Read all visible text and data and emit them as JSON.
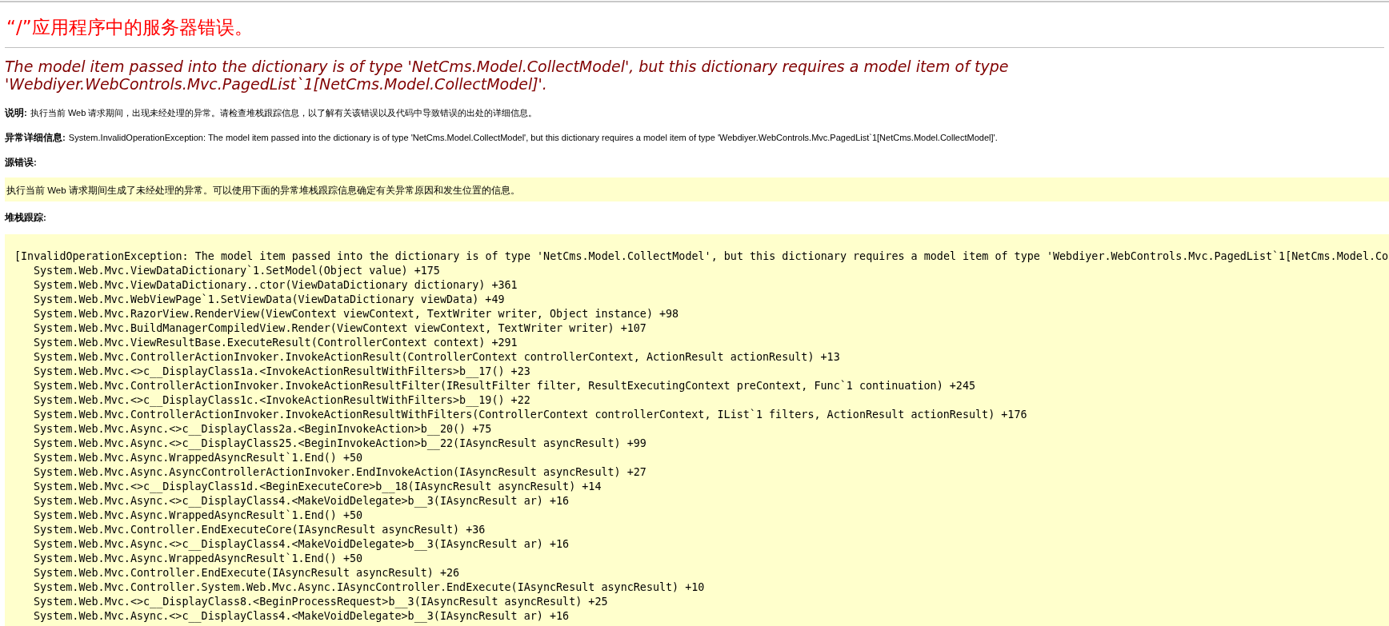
{
  "title": "“/”应用程序中的服务器错误。",
  "error_message": "The model item passed into the dictionary is of type 'NetCms.Model.CollectModel', but this dictionary requires a model item of type 'Webdiyer.WebControls.Mvc.PagedList`1[NetCms.Model.CollectModel]'.",
  "description": {
    "label": "说明:",
    "text": "执行当前 Web 请求期间，出现未经处理的异常。请检查堆栈跟踪信息，以了解有关该错误以及代码中导致错误的出处的详细信息。"
  },
  "exception_details": {
    "label": "异常详细信息:",
    "text": "System.InvalidOperationException: The model item passed into the dictionary is of type 'NetCms.Model.CollectModel', but this dictionary requires a model item of type 'Webdiyer.WebControls.Mvc.PagedList`1[NetCms.Model.CollectModel]'."
  },
  "source_error": {
    "label": "源错误:",
    "text": "执行当前 Web 请求期间生成了未经处理的异常。可以使用下面的异常堆栈跟踪信息确定有关异常原因和发生位置的信息。"
  },
  "stack_trace": {
    "label": "堆栈跟踪:",
    "exception_line": "[InvalidOperationException: The model item passed into the dictionary is of type 'NetCms.Model.CollectModel', but this dictionary requires a model item of type 'Webdiyer.WebControls.Mvc.PagedList`1[NetCms.Model.Co",
    "frames": [
      "System.Web.Mvc.ViewDataDictionary`1.SetModel(Object value) +175",
      "System.Web.Mvc.ViewDataDictionary..ctor(ViewDataDictionary dictionary) +361",
      "System.Web.Mvc.WebViewPage`1.SetViewData(ViewDataDictionary viewData) +49",
      "System.Web.Mvc.RazorView.RenderView(ViewContext viewContext, TextWriter writer, Object instance) +98",
      "System.Web.Mvc.BuildManagerCompiledView.Render(ViewContext viewContext, TextWriter writer) +107",
      "System.Web.Mvc.ViewResultBase.ExecuteResult(ControllerContext context) +291",
      "System.Web.Mvc.ControllerActionInvoker.InvokeActionResult(ControllerContext controllerContext, ActionResult actionResult) +13",
      "System.Web.Mvc.<>c__DisplayClass1a.<InvokeActionResultWithFilters>b__17() +23",
      "System.Web.Mvc.ControllerActionInvoker.InvokeActionResultFilter(IResultFilter filter, ResultExecutingContext preContext, Func`1 continuation) +245",
      "System.Web.Mvc.<>c__DisplayClass1c.<InvokeActionResultWithFilters>b__19() +22",
      "System.Web.Mvc.ControllerActionInvoker.InvokeActionResultWithFilters(ControllerContext controllerContext, IList`1 filters, ActionResult actionResult) +176",
      "System.Web.Mvc.Async.<>c__DisplayClass2a.<BeginInvokeAction>b__20() +75",
      "System.Web.Mvc.Async.<>c__DisplayClass25.<BeginInvokeAction>b__22(IAsyncResult asyncResult) +99",
      "System.Web.Mvc.Async.WrappedAsyncResult`1.End() +50",
      "System.Web.Mvc.Async.AsyncControllerActionInvoker.EndInvokeAction(IAsyncResult asyncResult) +27",
      "System.Web.Mvc.<>c__DisplayClass1d.<BeginExecuteCore>b__18(IAsyncResult asyncResult) +14",
      "System.Web.Mvc.Async.<>c__DisplayClass4.<MakeVoidDelegate>b__3(IAsyncResult ar) +16",
      "System.Web.Mvc.Async.WrappedAsyncResult`1.End() +50",
      "System.Web.Mvc.Controller.EndExecuteCore(IAsyncResult asyncResult) +36",
      "System.Web.Mvc.Async.<>c__DisplayClass4.<MakeVoidDelegate>b__3(IAsyncResult ar) +16",
      "System.Web.Mvc.Async.WrappedAsyncResult`1.End() +50",
      "System.Web.Mvc.Controller.EndExecute(IAsyncResult asyncResult) +26",
      "System.Web.Mvc.Controller.System.Web.Mvc.Async.IAsyncController.EndExecute(IAsyncResult asyncResult) +10",
      "System.Web.Mvc.<>c__DisplayClass8.<BeginProcessRequest>b__3(IAsyncResult asyncResult) +25",
      "System.Web.Mvc.Async.<>c__DisplayClass4.<MakeVoidDelegate>b__3(IAsyncResult ar) +16"
    ]
  }
}
